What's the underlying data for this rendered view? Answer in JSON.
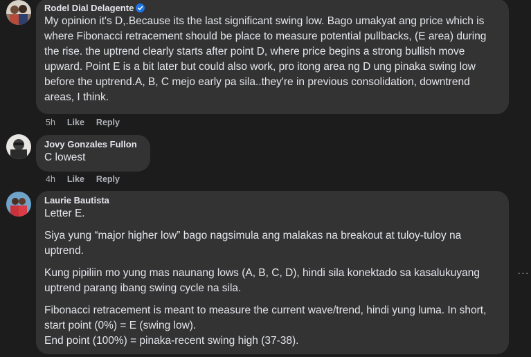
{
  "comments": [
    {
      "author": "Rodel Dial Delagente",
      "verified_icon": "verified-badge-icon",
      "text": "My opinion it's D,.Because its the last significant swing low. Bago umakyat ang price which is where Fibonacci retracement should be place to measure potential pullbacks, (E area) during the rise. the uptrend clearly starts after point D, where price begins a strong bullish move upward. Point E is a bit later but could also work, pro itong area ng D ung pinaka swing low before the uptrend.A, B, C mejo early pa sila..they're in previous consolidation, downtrend areas, I think.",
      "time": "5h",
      "like": "Like",
      "reply": "Reply"
    },
    {
      "author": "Jovy Gonzales Fullon",
      "text": "C lowest",
      "time": "4h",
      "like": "Like",
      "reply": "Reply"
    },
    {
      "author": "Laurie Bautista",
      "paragraphs": [
        "Letter E.",
        "Siya yung “major higher low” bago nagsimula ang malakas na breakout at tuloy-tuloy na uptrend.",
        "Kung pipiliin mo yung mas naunang lows (A, B, C, D), hindi sila konektado sa kasalukuyang uptrend parang ibang swing cycle na sila.",
        "Fibonacci retracement is meant to measure the current wave/trend, hindi yung luma. In short, start point (0%) = E (swing low).",
        "End point (100%) = pinaka-recent swing high (37-38)."
      ],
      "more_icon": "more-options-icon",
      "more_label": "···"
    }
  ]
}
